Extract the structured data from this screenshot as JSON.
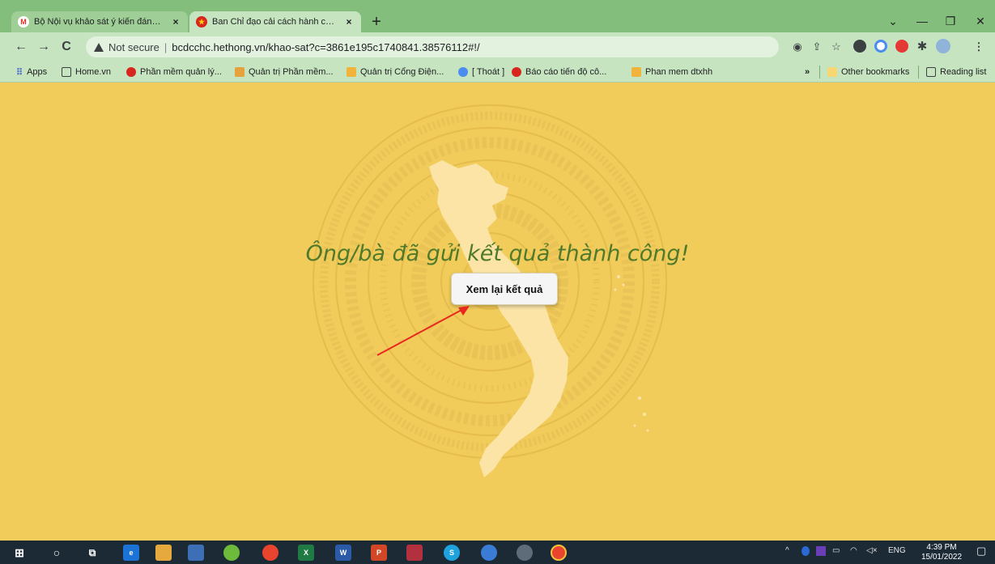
{
  "tabs": [
    {
      "title": "Bộ Nội vụ khảo sát ý kiến đánh giá",
      "close": "×",
      "active": false
    },
    {
      "title": "Ban Chỉ đạo cải cách hành chính",
      "close": "×",
      "active": true
    }
  ],
  "new_tab_label": "+",
  "window_controls": {
    "chevron": "⌄",
    "minimize": "—",
    "restore": "❐",
    "close": "✕"
  },
  "address_bar": {
    "back": "←",
    "forward": "→",
    "reload": "C",
    "security_label": "Not secure",
    "separator": "|",
    "url": "bcdcchc.hethong.vn/khao-sat?c=3861e195c1740841.38576112#!/"
  },
  "bookmarks": {
    "items": [
      {
        "label": "Apps"
      },
      {
        "label": "Home.vn"
      },
      {
        "label": "Phần mềm quản lý..."
      },
      {
        "label": "Quản trị Phần mềm..."
      },
      {
        "label": "Quản trị Cổng Điện..."
      },
      {
        "label": "[ Thoát ]"
      },
      {
        "label": "Báo cáo tiến độ cô..."
      },
      {
        "label": "Phan mem dtxhh"
      }
    ],
    "more": "»",
    "other": "Other bookmarks",
    "reading_list": "Reading list"
  },
  "page": {
    "message": "Ông/bà đã gửi kết quả thành công!",
    "review_button": "Xem lại kết quả"
  },
  "taskbar": {
    "language": "ENG",
    "time": "4:39 PM",
    "date": "15/01/2022"
  },
  "colors": {
    "tab_strip": "#84be7c",
    "toolbar": "#c6e4bf",
    "page_background": "#f1cc5b",
    "message_text": "#4f7a2b",
    "map_fill": "#fbe4a6",
    "annotation_arrow": "#e8281e",
    "taskbar": "#1c2a36"
  }
}
